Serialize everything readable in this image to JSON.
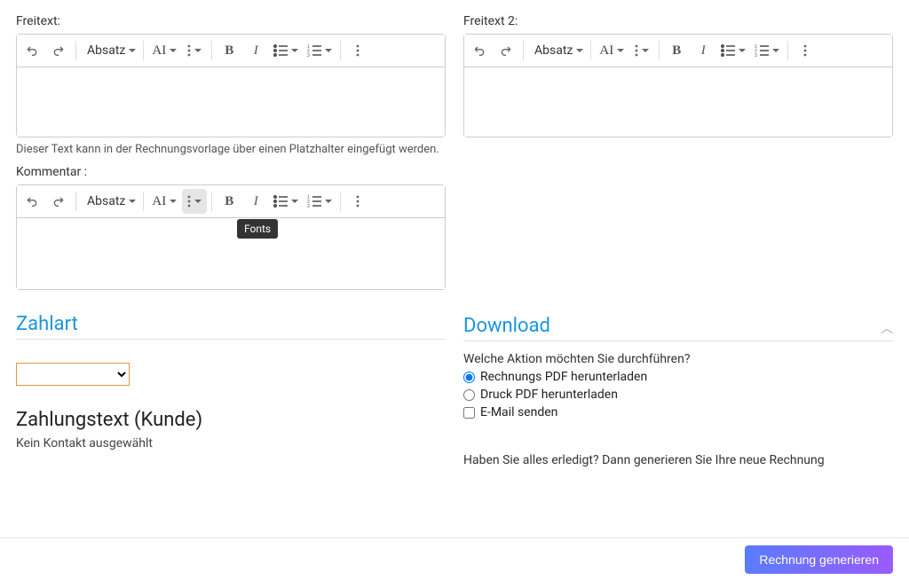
{
  "editors": {
    "freitext": {
      "label": "Freitext:",
      "help": "Dieser Text kann in der Rechnungsvorlage über einen Platzhalter eingefügt werden.",
      "format": "Absatz"
    },
    "freitext2": {
      "label": "Freitext 2:",
      "format": "Absatz"
    },
    "kommentar": {
      "label": "Kommentar :",
      "format": "Absatz",
      "tooltip": "Fonts"
    }
  },
  "zahlart": {
    "heading": "Zahlart",
    "zahlungstext_heading": "Zahlungstext (Kunde)",
    "no_contact": "Kein Kontakt ausgewählt"
  },
  "download": {
    "heading": "Download",
    "question": "Welche Aktion möchten Sie durchführen?",
    "options": {
      "pdf": "Rechnungs PDF herunterladen",
      "druck": "Druck PDF herunterladen",
      "email": "E-Mail senden"
    },
    "done": "Haben Sie alles erledigt? Dann generieren Sie Ihre neue Rechnung"
  },
  "footer": {
    "generate": "Rechnung generieren"
  }
}
